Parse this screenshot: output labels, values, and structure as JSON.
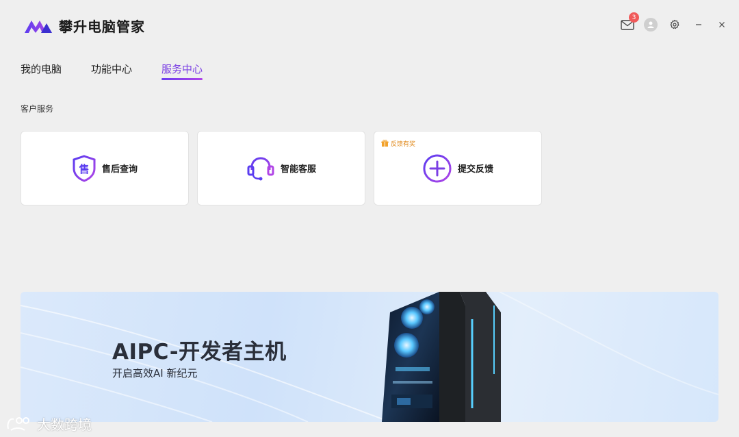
{
  "app": {
    "title": "攀升电脑管家",
    "accent_color": "#7b3fe4",
    "mail_badge": "3"
  },
  "tabs": [
    {
      "label": "我的电脑",
      "active": false
    },
    {
      "label": "功能中心",
      "active": false
    },
    {
      "label": "服务中心",
      "active": true
    }
  ],
  "section": {
    "title": "客户服务"
  },
  "cards": [
    {
      "label": "售后查询",
      "icon": "after-sales-shield-icon"
    },
    {
      "label": "智能客服",
      "icon": "headset-icon"
    },
    {
      "label": "提交反馈",
      "icon": "plus-circle-icon",
      "tag": "反馈有奖"
    }
  ],
  "banner": {
    "title": "AIPC-开发者主机",
    "subtitle": "开启高效AI 新纪元"
  },
  "watermark": {
    "text": "大数跨境"
  }
}
